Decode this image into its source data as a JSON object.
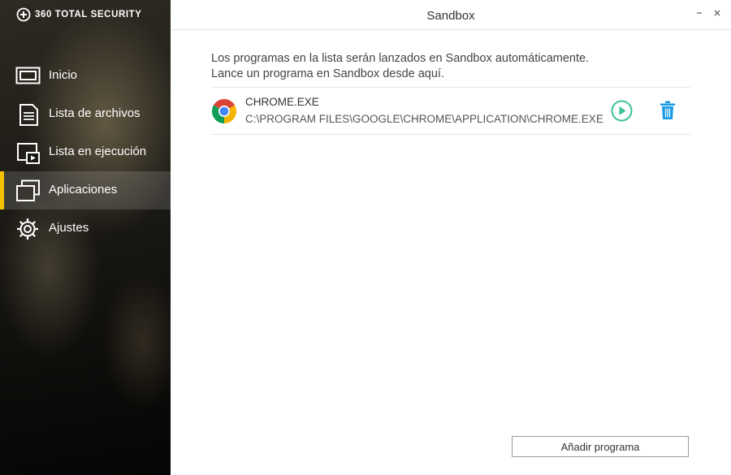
{
  "brand": {
    "name": "360 TOTAL SECURITY",
    "logo_icon": "plus-circle-icon"
  },
  "sidebar": {
    "items": [
      {
        "label": "Inicio",
        "icon": "monitor-icon",
        "active": false
      },
      {
        "label": "Lista de archivos",
        "icon": "document-list-icon",
        "active": false
      },
      {
        "label": "Lista en ejecución",
        "icon": "running-window-icon",
        "active": false
      },
      {
        "label": "Aplicaciones",
        "icon": "stacked-windows-icon",
        "active": true
      },
      {
        "label": "Ajustes",
        "icon": "gear-icon",
        "active": false
      }
    ],
    "accent_color": "#f2c200"
  },
  "window": {
    "title": "Sandbox",
    "minimize_icon": "minimize-icon",
    "close_icon": "close-icon"
  },
  "main": {
    "description_line1": "Los programas en la lista serán lanzados en Sandbox automáticamente.",
    "description_line2": "Lance un programa en Sandbox desde aquí.",
    "apps": [
      {
        "name": "CHROME.EXE",
        "path": "C:\\PROGRAM FILES\\GOOGLE\\CHROME\\APPLICATION\\CHROME.EXE",
        "icon": "chrome-icon",
        "run_icon": "play-circle-icon",
        "delete_icon": "trash-icon"
      }
    ],
    "add_button_label": "Añadir programa",
    "run_color": "#3cc28f",
    "delete_color": "#1a9be6"
  }
}
